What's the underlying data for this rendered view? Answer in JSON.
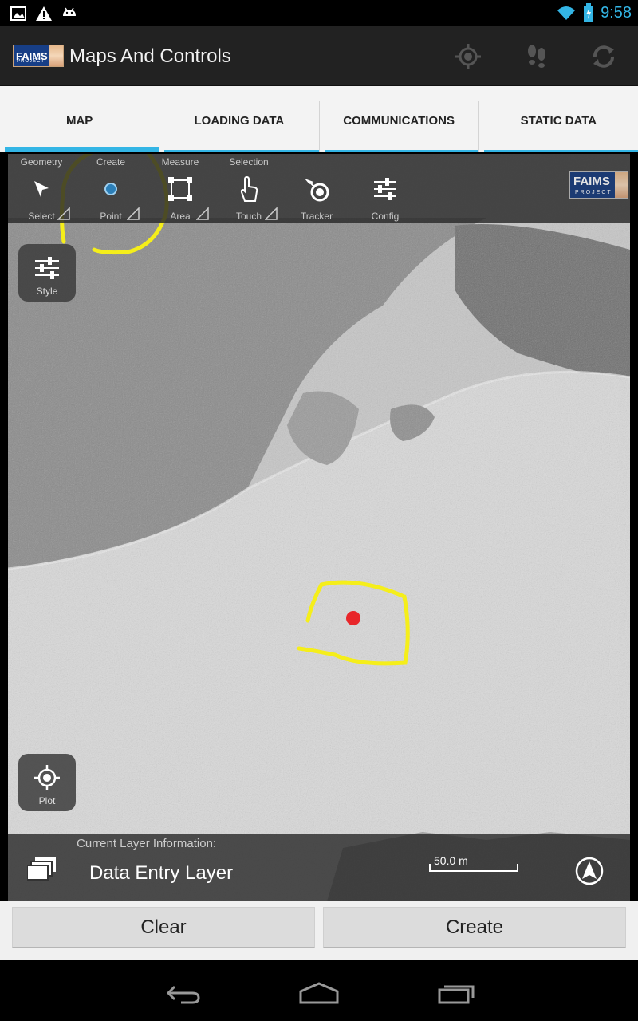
{
  "status_bar": {
    "time": "9:58",
    "icons": [
      "picture-icon",
      "warning-icon",
      "android-icon",
      "wifi-icon",
      "battery-icon"
    ],
    "accent": "#33b5e5"
  },
  "action_bar": {
    "logo_text": "FAIMS",
    "logo_sub": "PROJECT",
    "title": "Maps And Controls",
    "icons": [
      "gps-target-icon",
      "footsteps-icon",
      "sync-icon"
    ]
  },
  "tabs": [
    {
      "label": "MAP",
      "active": true
    },
    {
      "label": "LOADING DATA",
      "active": false
    },
    {
      "label": "COMMUNICATIONS",
      "active": false
    },
    {
      "label": "STATIC DATA",
      "active": false
    }
  ],
  "toolbar": {
    "tools": [
      {
        "group": "Geometry",
        "label": "Select",
        "icon": "pointer-icon",
        "submenu": true
      },
      {
        "group": "Create",
        "label": "Point",
        "icon": "point-icon",
        "submenu": true
      },
      {
        "group": "Measure",
        "label": "Area",
        "icon": "area-icon",
        "submenu": true
      },
      {
        "group": "Selection",
        "label": "Touch",
        "icon": "touch-icon",
        "submenu": true
      },
      {
        "group": "",
        "label": "Tracker",
        "icon": "tracker-icon",
        "submenu": false
      },
      {
        "group": "",
        "label": "Config",
        "icon": "sliders-icon",
        "submenu": false
      }
    ],
    "badge_text": "FAIMS",
    "badge_sub": "PROJECT"
  },
  "map": {
    "style_button": "Style",
    "plot_button": "Plot",
    "point_color": "#e8262a",
    "annotation_color": "#f5ee1a"
  },
  "layer_bar": {
    "caption": "Current Layer Information:",
    "name": "Data Entry Layer",
    "scale_label": "50.0 m"
  },
  "buttons": {
    "clear": "Clear",
    "create": "Create"
  }
}
